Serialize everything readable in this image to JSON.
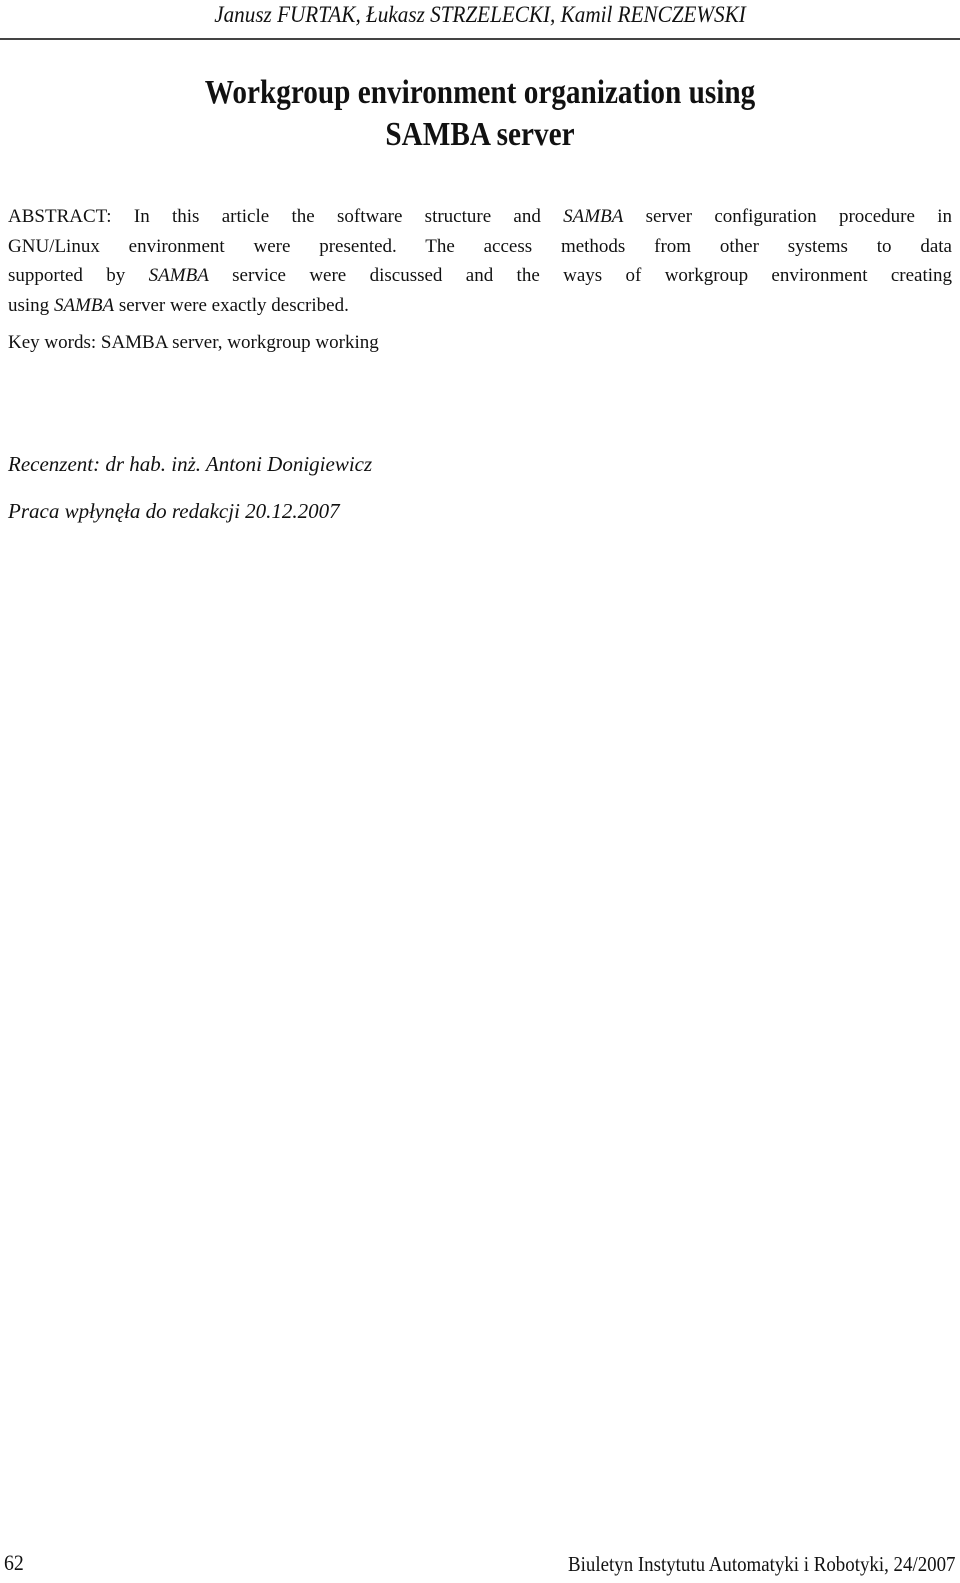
{
  "running_head": "Janusz FURTAK, Łukasz STRZELECKI, Kamil RENCZEWSKI",
  "title": {
    "line1": "Workgroup environment organization using",
    "line2": "SAMBA server"
  },
  "abstract": {
    "lines": [
      [
        "ABSTRACT: In this article the software structure and ",
        "SAMBA",
        " server configuration procedure in"
      ],
      [
        "GNU/Linux environment were presented. The access methods from other systems to data"
      ],
      [
        "supported by ",
        "SAMBA",
        " service were discussed and the ways of workgroup environment creating"
      ],
      [
        "using ",
        "SAMBA",
        " server were exactly described."
      ]
    ]
  },
  "keywords": "Key words: SAMBA server, workgroup working",
  "reviewer": "Recenzent: dr hab. inż. Antoni Donigiewicz",
  "received": "Praca wpłynęła do redakcji 20.12.2007",
  "footer": {
    "page_number": "62",
    "journal": "Biuletyn Instytutu Automatyki i Robotyki, 24/2007"
  }
}
